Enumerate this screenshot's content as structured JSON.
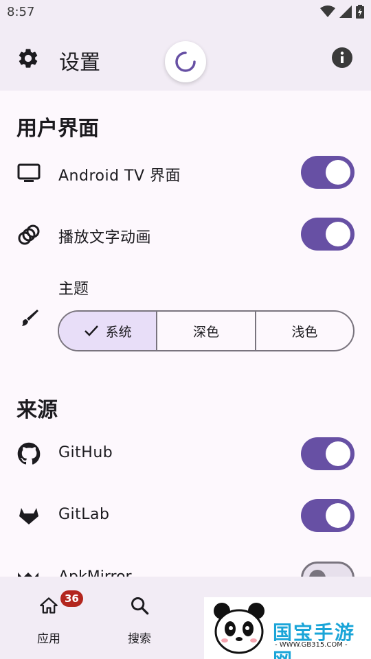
{
  "status_bar": {
    "time": "8:57",
    "icons": [
      "wifi-icon",
      "signal-icon",
      "battery-charging-icon"
    ]
  },
  "app_bar": {
    "title": "设置",
    "leading_icon": "gear-icon",
    "trailing_icon": "info-icon"
  },
  "sections": {
    "ui": {
      "title": "用户界面",
      "tv_label": "Android TV 界面",
      "tv_enabled": true,
      "text_anim_label": "播放文字动画",
      "text_anim_enabled": true,
      "theme_label": "主题",
      "theme_options": [
        "系统",
        "深色",
        "浅色"
      ],
      "theme_selected": "系统"
    },
    "sources": {
      "title": "来源",
      "github_label": "GitHub",
      "github_enabled": true,
      "gitlab_label": "GitLab",
      "gitlab_enabled": true,
      "apkmirror_label": "ApkMirror",
      "apkmirror_enabled": false
    }
  },
  "bottom_nav": {
    "apps_label": "应用",
    "apps_badge": "36",
    "search_label": "搜索"
  },
  "watermark": {
    "text": "国宝手游网",
    "url": "- WWW.GB315.COM -"
  },
  "colors": {
    "accent": "#6750a4",
    "surface": "#f2ecf5",
    "badge": "#b3261e",
    "selected": "#e8def8"
  }
}
